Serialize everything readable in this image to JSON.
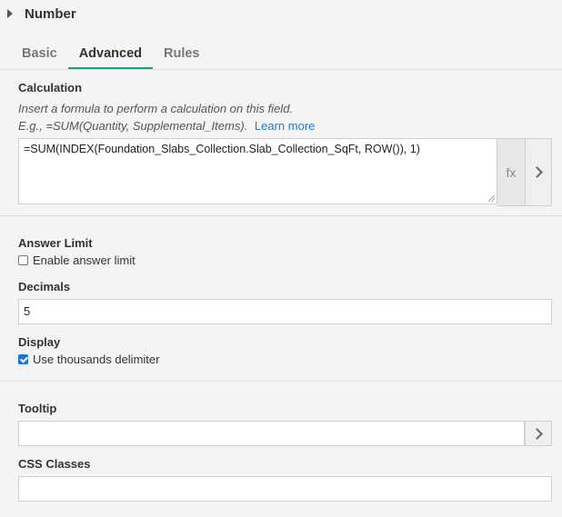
{
  "header": {
    "title": "Number"
  },
  "tabs": [
    {
      "label": "Basic",
      "active": false
    },
    {
      "label": "Advanced",
      "active": true
    },
    {
      "label": "Rules",
      "active": false
    }
  ],
  "calculation": {
    "label": "Calculation",
    "hint_line1": "Insert a formula to perform a calculation on this field.",
    "hint_line2": "E.g., =SUM(Quantity, Supplemental_Items).",
    "learn_more": "Learn more",
    "formula": "=SUM(INDEX(Foundation_Slabs_Collection.Slab_Collection_SqFt, ROW()), 1)",
    "fx_label": "fx"
  },
  "answer_limit": {
    "label": "Answer Limit",
    "checkbox_label": "Enable answer limit",
    "checked": false
  },
  "decimals": {
    "label": "Decimals",
    "value": "5"
  },
  "display": {
    "label": "Display",
    "checkbox_label": "Use thousands delimiter",
    "checked": true
  },
  "tooltip": {
    "label": "Tooltip",
    "value": ""
  },
  "css_classes": {
    "label": "CSS Classes",
    "value": ""
  },
  "colors": {
    "accent": "#17a085",
    "link": "#2a78c0",
    "checkbox": "#1a73e8"
  }
}
